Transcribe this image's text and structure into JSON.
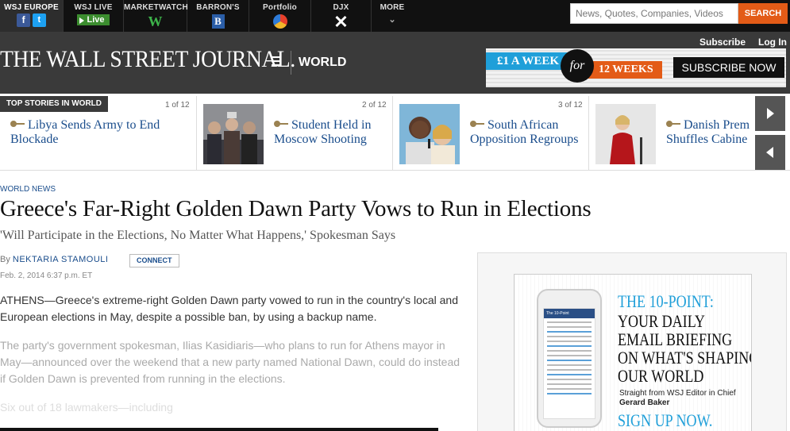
{
  "nav": {
    "items": [
      {
        "label": "WSJ EUROPE"
      },
      {
        "label": "WSJ LIVE",
        "badge": "Live"
      },
      {
        "label": "MARKETWATCH",
        "glyph": "W"
      },
      {
        "label": "BARRON'S",
        "glyph": "B"
      },
      {
        "label": "Portfolio"
      },
      {
        "label": "DJX"
      },
      {
        "label": "MORE"
      }
    ],
    "search_placeholder": "News, Quotes, Companies, Videos",
    "search_button": "SEARCH",
    "icons": [
      "facebook-icon",
      "twitter-icon",
      "play-icon",
      "marketwatch-icon",
      "barrons-icon",
      "pie-chart-icon",
      "close-icon",
      "chevron-down-icon",
      "hamburger-menu-icon",
      "key-icon"
    ]
  },
  "masthead": {
    "logo": "THE WALL STREET JOURNAL.",
    "section": "WORLD",
    "subscribe": "Subscribe",
    "login": "Log In",
    "promo": {
      "price": "£1 A WEEK",
      "for": "for",
      "weeks": "12 WEEKS",
      "cta": "SUBSCRIBE NOW"
    }
  },
  "top_stories": {
    "label": "TOP STORIES IN WORLD",
    "stories": [
      {
        "count": "1 of 12",
        "headline": "Libya Sends Army to End Blockade"
      },
      {
        "count": "2 of 12",
        "headline": "Student Held in Moscow Shooting"
      },
      {
        "count": "3 of 12",
        "headline": "South African Opposition Regroups"
      },
      {
        "count": "",
        "headline": "Danish Prem Shuffles Cabine"
      }
    ]
  },
  "article": {
    "kicker": "WORLD NEWS",
    "title": "Greece's Far-Right Golden Dawn Party Vows to Run in Elections",
    "deck": "'Will Participate in the Elections, No Matter What Happens,' Spokesman Says",
    "by": "By",
    "author": "NEKTARIA STAMOULI",
    "connect": "CONNECT",
    "date": "Feb. 2, 2014 6:37 p.m. ET",
    "paragraphs": [
      "ATHENS—Greece's extreme-right Golden Dawn party vowed to run in the country's local and European elections in May, despite a possible ban, by using a backup name.",
      "The party's government spokesman, Ilias Kasidiaris—who plans to run for Athens mayor in May—announced over the weekend that a new party named National Dawn, could do instead if Golden Dawn is prevented from running in the elections.",
      "Six out of 18 lawmakers—including"
    ]
  },
  "ad": {
    "phone_head": "The 10-Point",
    "headline_blue": "THE 10-POINT:",
    "headline_black": [
      "YOUR DAILY",
      "EMAIL BRIEFING",
      "ON WHAT'S SHAPING",
      "OUR WORLD"
    ],
    "sub1": "Straight from WSJ Editor in Chief",
    "sub2": "Gerard Baker",
    "signup": "SIGN UP NOW."
  },
  "colors": {
    "accent_orange": "#e35b17",
    "link_blue": "#1a4d8c",
    "promo_blue": "#1f9fd9",
    "masthead_gray": "#3a3a3a"
  }
}
